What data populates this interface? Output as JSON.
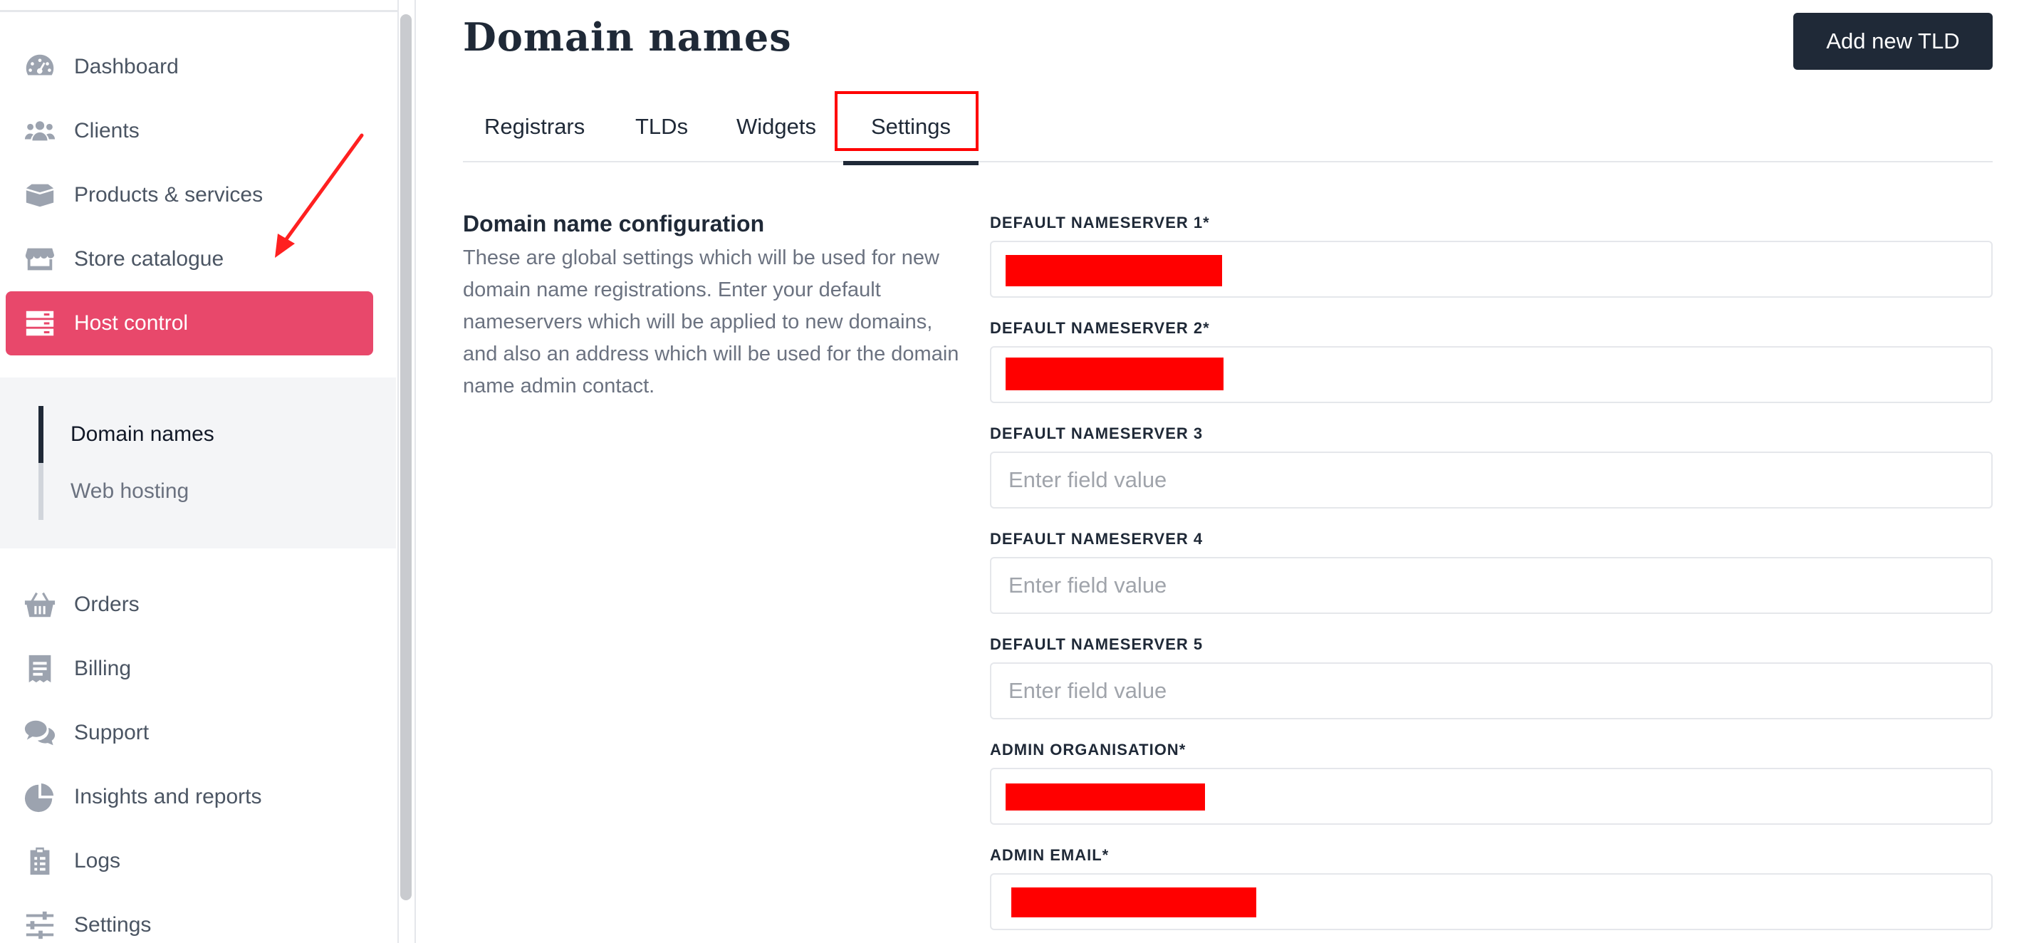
{
  "sidebar": {
    "items": [
      {
        "label": "Dashboard",
        "icon": "gauge-icon"
      },
      {
        "label": "Clients",
        "icon": "users-icon"
      },
      {
        "label": "Products & services",
        "icon": "box-icon"
      },
      {
        "label": "Store catalogue",
        "icon": "store-icon"
      },
      {
        "label": "Host control",
        "icon": "server-icon",
        "active": true
      },
      {
        "label": "Orders",
        "icon": "basket-icon"
      },
      {
        "label": "Billing",
        "icon": "receipt-icon"
      },
      {
        "label": "Support",
        "icon": "comments-icon"
      },
      {
        "label": "Insights and reports",
        "icon": "pie-chart-icon"
      },
      {
        "label": "Logs",
        "icon": "clipboard-icon"
      },
      {
        "label": "Settings",
        "icon": "sliders-icon"
      }
    ],
    "subitems": [
      {
        "label": "Domain names",
        "active": true
      },
      {
        "label": "Web hosting",
        "active": false
      }
    ]
  },
  "header": {
    "title": "Domain names",
    "add_button_label": "Add new TLD"
  },
  "tabs": [
    {
      "label": "Registrars"
    },
    {
      "label": "TLDs"
    },
    {
      "label": "Widgets"
    },
    {
      "label": "Settings",
      "active": true
    }
  ],
  "section": {
    "title": "Domain name configuration",
    "description": "These are global settings which will be used for new domain name registrations. Enter your default nameservers which will be applied to new domains, and also an address which will be used for the domain name admin contact."
  },
  "fields": [
    {
      "label": "DEFAULT NAMESERVER 1*",
      "value": "",
      "placeholder": "",
      "redacted": true
    },
    {
      "label": "DEFAULT NAMESERVER 2*",
      "value": "",
      "placeholder": "",
      "redacted": true
    },
    {
      "label": "DEFAULT NAMESERVER 3",
      "value": "",
      "placeholder": "Enter field value"
    },
    {
      "label": "DEFAULT NAMESERVER 4",
      "value": "",
      "placeholder": "Enter field value"
    },
    {
      "label": "DEFAULT NAMESERVER 5",
      "value": "",
      "placeholder": "Enter field value"
    },
    {
      "label": "ADMIN ORGANISATION*",
      "value": "",
      "placeholder": "",
      "redacted": true
    },
    {
      "label": "ADMIN EMAIL*",
      "value": "",
      "placeholder": "",
      "redacted": true
    }
  ],
  "colors": {
    "accent": "#e8486b",
    "dark": "#1f2937",
    "highlight": "#ff0000"
  }
}
